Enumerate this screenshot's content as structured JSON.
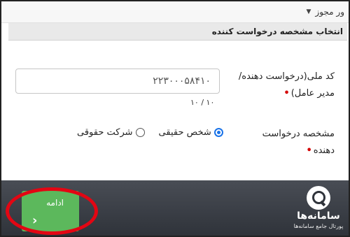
{
  "top_bar": {
    "select_value": "ور مجوز",
    "caret": "▼"
  },
  "section": {
    "title": "انتخاب مشخصه درخواست کننده"
  },
  "national_id": {
    "label": "کد ملی(درخواست دهنده/مدیر عامل)",
    "required_mark": "•",
    "value": "۲۲۳۰۰۰۵۸۴۱۰",
    "counter": "۱۰ / ۱۰"
  },
  "applicant_type": {
    "label": "مشخصه درخواست دهنده",
    "required_mark": "•",
    "options": [
      {
        "label": "شخص حقیقی",
        "checked": true
      },
      {
        "label": "شرکت حقوقی",
        "checked": false
      }
    ]
  },
  "footer": {
    "continue_label": "ادامه",
    "continue_arrow": "‹",
    "brand_name": "سامانه‌ها",
    "brand_tagline": "پورتال جامع سامانه‌ها"
  },
  "colors": {
    "button_green": "#5cb85c",
    "highlight_red": "#e30613",
    "radio_blue": "#1a73e8",
    "footer_dark": "#3a3e45"
  },
  "icons": [
    "caret-down-icon",
    "radio-checked-icon",
    "radio-unchecked-icon",
    "chevron-left-icon",
    "search-logo-icon"
  ]
}
